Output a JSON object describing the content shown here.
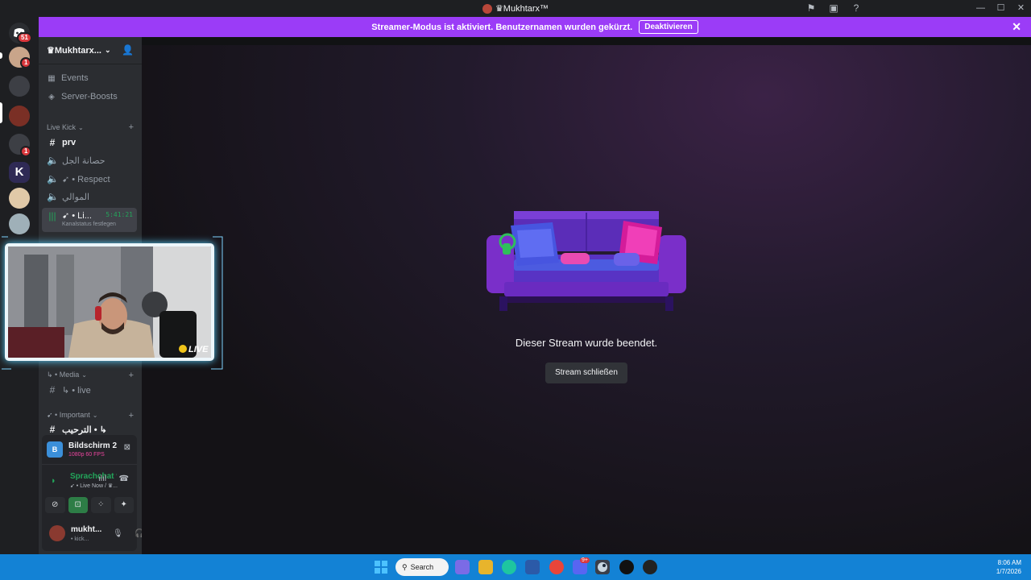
{
  "window": {
    "title": "♛Mukhtarx™",
    "controls": [
      "—",
      "☐",
      "✕"
    ]
  },
  "banner": {
    "text": "Streamer-Modus ist aktiviert. Benutzernamen wurden gekürzt.",
    "button": "Deaktivieren"
  },
  "rail": {
    "badges": [
      "51",
      "1",
      "1"
    ]
  },
  "sidebar": {
    "server_name": "♛Mukhtarx...",
    "nav": [
      {
        "icon": "calendar-icon",
        "label": "Events"
      },
      {
        "icon": "boost-icon",
        "label": "Server-Boosts"
      }
    ],
    "categories": {
      "live_kick": "Live Kick",
      "media": "↳ • Media",
      "important": "➹ • Important"
    },
    "channels": {
      "prv": "prv",
      "voice1": "حصانة الجل",
      "voice2": "➹ • Respect",
      "voice3": "الموالي",
      "live": "➹ • Li...",
      "live_timer": "5:41:21",
      "live_status": "Kanalstatus festlegen",
      "media_live": "↳ • live",
      "important_1": "الترحيب • ↳"
    }
  },
  "stream_panel": {
    "title": "Bildschirm 2",
    "sub": "1080p 60 FPS"
  },
  "voice_panel": {
    "title": "Sprachchat verbunden",
    "sub": "➹ • Live Now / ♛..."
  },
  "user_panel": {
    "name": "mukht...",
    "status": "• kick..."
  },
  "main": {
    "message": "Dieser Stream wurde beendet.",
    "button": "Stream schließen"
  },
  "cam": {
    "live": "LIVE"
  },
  "taskbar": {
    "search": "Search",
    "time": "8:06 AM",
    "date": "1/7/2026",
    "discord_badge": "9+"
  },
  "colors": {
    "banner": "#9b3cf7",
    "taskbar": "#1382d5",
    "online": "#23a55a",
    "sidebar": "#2b2d31"
  }
}
